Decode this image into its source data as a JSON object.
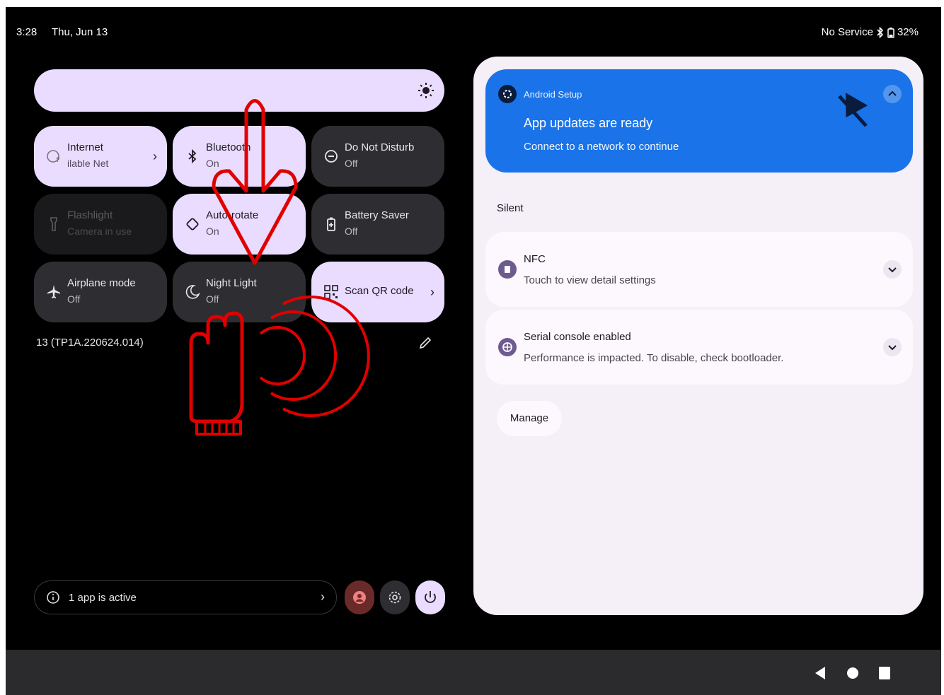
{
  "status_bar": {
    "time": "3:28",
    "date": "Thu, Jun 13",
    "service": "No Service",
    "battery": "32%"
  },
  "quick_settings": {
    "tiles": [
      {
        "title": "Internet",
        "subtitle": "ilable     Net",
        "icon": "internet-icon"
      },
      {
        "title": "Bluetooth",
        "subtitle": "On",
        "icon": "bluetooth-icon"
      },
      {
        "title": "Do Not Disturb",
        "subtitle": "Off",
        "icon": "dnd-icon"
      },
      {
        "title": "Flashlight",
        "subtitle": "Camera in use",
        "icon": "flashlight-icon"
      },
      {
        "title": "Auto-rotate",
        "subtitle": "On",
        "icon": "rotate-icon"
      },
      {
        "title": "Battery Saver",
        "subtitle": "Off",
        "icon": "battery-saver-icon"
      },
      {
        "title": "Airplane mode",
        "subtitle": "Off",
        "icon": "airplane-icon"
      },
      {
        "title": "Night Light",
        "subtitle": "Off",
        "icon": "moon-icon"
      },
      {
        "title": "Scan QR code",
        "subtitle": "",
        "icon": "qr-code-icon"
      }
    ],
    "build_number": "13 (TP1A.220624.014)",
    "security_footer": "1 app is active"
  },
  "notifications": {
    "heads_up": {
      "app": "Android Setup",
      "title": "App updates are ready",
      "text": "Connect to a network to continue"
    },
    "section_label": "Silent",
    "items": [
      {
        "title": "NFC",
        "text": "Touch to view detail settings"
      },
      {
        "title": "Serial console enabled",
        "text": "Performance is impacted. To disable, check bootloader."
      }
    ],
    "manage_label": "Manage"
  },
  "colors": {
    "accent": "#e9dcff",
    "heads_up_bg": "#1a73e8",
    "overlay": "#e00000"
  }
}
